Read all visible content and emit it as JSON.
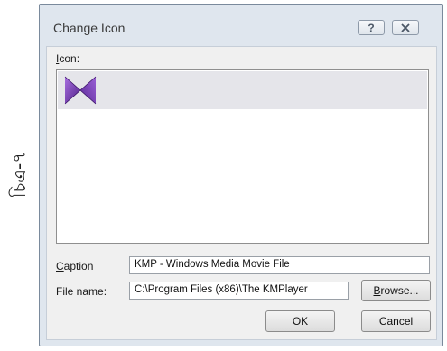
{
  "side_caption": "চিত্র-৭",
  "dialog": {
    "title": "Change Icon",
    "help_glyph": "?",
    "icon_label_key": "I",
    "icon_label_rest": "con:",
    "icon_list": [
      {
        "icon": "kmplayer-bowtie-icon"
      }
    ],
    "caption_label_key": "C",
    "caption_label_rest": "aption",
    "caption_value": "KMP - Windows Media Movie File",
    "filename_label": "File name:",
    "filename_value": "C:\\Program Files (x86)\\The KMPlayer",
    "browse_key": "B",
    "browse_rest": "rowse...",
    "ok_label": "OK",
    "cancel_label": "Cancel"
  },
  "colors": {
    "window_frame": "#dfe6ee",
    "client_bg": "#f0f0f0",
    "selected_item": "#e5e5ea",
    "icon_purple": "#7b3fb5"
  }
}
